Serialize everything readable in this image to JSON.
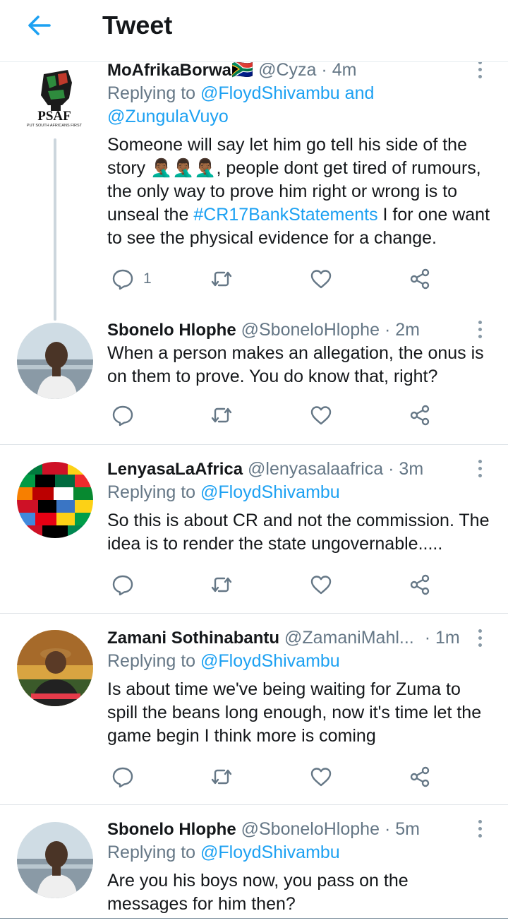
{
  "header": {
    "title": "Tweet",
    "back_icon": "back-arrow-icon",
    "accent": "#1da1f2"
  },
  "tweets": [
    {
      "name": "MoAfrikaBorwa",
      "flag": "🇿🇦",
      "handle": "@Cyza",
      "dot": "·",
      "time": "4m",
      "reply_prefix": "Replying to ",
      "reply_mention_1": "@FloydShivambu",
      "reply_join": " and",
      "reply_mention_2": "@ZungulaVuyo",
      "body_1": "Someone will say let him go tell his side of the story ",
      "emoji": "🤦🏾‍♂️🤦🏾‍♂️🤦🏾‍♂️",
      "body_2": ", people dont get tired of rumours, the only way to prove him right or wrong is to unseal the ",
      "hashtag": "#CR17BankStatements",
      "body_3": " I for one want to see the physical evidence for a change.",
      "reply_count": "1",
      "avatar_text": "PSAF",
      "avatar_subtext": "PUT SOUTH AFRICANS FIRST"
    },
    {
      "name": "Sbonelo Hlophe",
      "handle": "@SboneloHlophe",
      "dot": "·",
      "time": "2m",
      "body": "When a person makes an allegation, the onus is on them to prove. You do know that, right?"
    },
    {
      "name": "LenyasaLaAfrica",
      "handle": "@lenyasalaafrica",
      "dot": "·",
      "time": "3m",
      "reply_prefix": "Replying to ",
      "reply_mention": "@FloydShivambu",
      "body": "So this is about CR and not the commission. The idea is to render the state ungovernable....."
    },
    {
      "name": "Zamani Sothinabantu",
      "handle": "@ZamaniMahl...",
      "dot": "·",
      "time": "1m",
      "reply_prefix": "Replying to ",
      "reply_mention": "@FloydShivambu",
      "body": "Is about time we've being waiting for Zuma to spill the beans long enough, now it's time let the game begin I think more is coming"
    },
    {
      "name": "Sbonelo Hlophe",
      "handle": "@SboneloHlophe",
      "dot": "·",
      "time": "5m",
      "reply_prefix": "Replying to ",
      "reply_mention": "@FloydShivambu",
      "body": "Are you his boys now, you pass on the messages for him then?"
    }
  ],
  "action_icons": [
    "reply-icon",
    "retweet-icon",
    "like-icon",
    "share-icon"
  ]
}
